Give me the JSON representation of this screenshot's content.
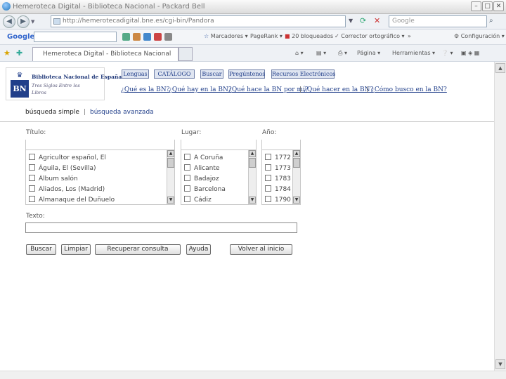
{
  "window": {
    "title": "Hemeroteca Digital - Biblioteca Nacional - Packard Bell"
  },
  "address_bar": {
    "url": "http://hemerotecadigital.bne.es/cgi-bin/Pandora",
    "search_placeholder": "Google"
  },
  "toolbar": {
    "google_label": "Google",
    "items": [
      "Marcadores",
      "PageRank",
      "20 bloqueados",
      "Corrector ortográfico",
      "Configuración"
    ]
  },
  "tab": {
    "title": "Hemeroteca Digital - Biblioteca Nacional",
    "commands": [
      "Página",
      "Herramientas"
    ]
  },
  "logo": {
    "name": "Biblioteca Nacional de España",
    "tagline": "Tres Siglos Entre los Libros",
    "mark": "BN"
  },
  "nav_buttons": [
    "Lenguas",
    "CATÁLOGO",
    "Buscar",
    "Pregúntenos",
    "Recursos Electrónicos"
  ],
  "questions": [
    "¿Qué es la BN?",
    "¿Qué hay en la BN?",
    "¿Qué hace la BN por mí?",
    "¿Qué hacer en la BN?",
    "¿Cómo busco en la BN?"
  ],
  "search_tabs": {
    "simple": "búsqueda simple",
    "advanced": "búsqueda avanzada",
    "separator": "|"
  },
  "filters": {
    "titulo": {
      "label": "Título:",
      "items": [
        "Agricultor español, El",
        "Águila, El (Sevilla)",
        "Álbum salón",
        "Aliados, Los (Madrid)",
        "Almanaque del Duñuelo"
      ]
    },
    "lugar": {
      "label": "Lugar:",
      "items": [
        "A Coruña",
        "Alicante",
        "Badajoz",
        "Barcelona",
        "Cádiz"
      ]
    },
    "anio": {
      "label": "Año:",
      "items": [
        "1772",
        "1773",
        "1783",
        "1784",
        "1790"
      ]
    }
  },
  "texto": {
    "label": "Texto:",
    "value": ""
  },
  "actions": [
    "Buscar",
    "Limpiar",
    "Recuperar consulta",
    "Ayuda",
    "Volver al inicio"
  ]
}
